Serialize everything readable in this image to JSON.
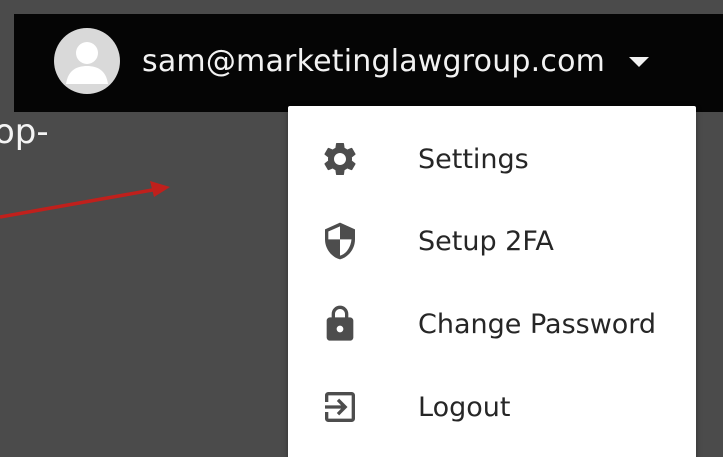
{
  "header": {
    "email": "sam@marketinglawgroup.com",
    "avatar_icon": "user-avatar-icon",
    "caret_icon": "caret-down-icon"
  },
  "background_text": "op-",
  "annotation": {
    "arrow_color": "#c0201c"
  },
  "menu": {
    "items": [
      {
        "label": "Settings",
        "icon": "gear-icon"
      },
      {
        "label": "Setup 2FA",
        "icon": "shield-icon"
      },
      {
        "label": "Change Password",
        "icon": "lock-icon"
      },
      {
        "label": "Logout",
        "icon": "logout-icon"
      }
    ]
  },
  "colors": {
    "page_background": "#4b4b4b",
    "topbar": "#050505",
    "menu_background": "#ffffff",
    "menu_text": "#262626",
    "icon": "#4d4d4d"
  }
}
